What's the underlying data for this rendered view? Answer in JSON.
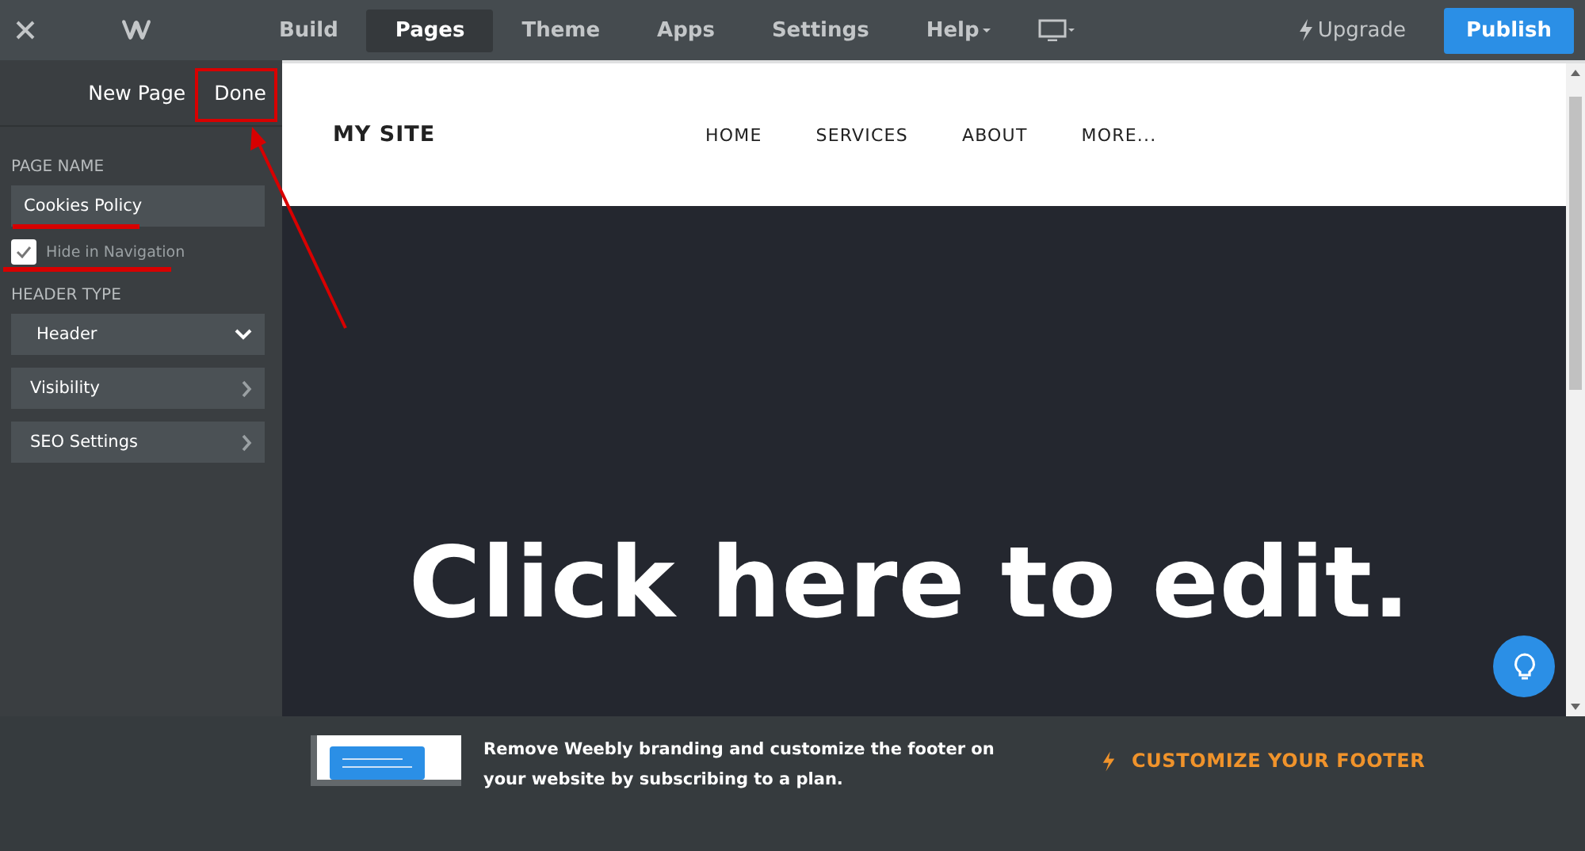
{
  "topbar": {
    "tabs": [
      {
        "label": "Build",
        "selected": false
      },
      {
        "label": "Pages",
        "selected": true
      },
      {
        "label": "Theme",
        "selected": false
      },
      {
        "label": "Apps",
        "selected": false
      },
      {
        "label": "Settings",
        "selected": false
      },
      {
        "label": "Help",
        "selected": false
      }
    ],
    "upgrade": "Upgrade",
    "publish": "Publish"
  },
  "sidebar": {
    "title": "New Page",
    "done": "Done",
    "page_name_label": "PAGE NAME",
    "page_name": "Cookies Policy",
    "hide_in_navigation": {
      "label": "Hide in Navigation",
      "checked": true
    },
    "header_type_label": "HEADER TYPE",
    "items": [
      {
        "kind": "select",
        "label": "Header"
      },
      {
        "kind": "link",
        "label": "Visibility"
      },
      {
        "kind": "link",
        "label": "SEO Settings"
      }
    ]
  },
  "site": {
    "title": "MY SITE",
    "nav": [
      "HOME",
      "SERVICES",
      "ABOUT",
      "MORE..."
    ],
    "hero": "Click here to edit."
  },
  "footer_banner": {
    "text": "Remove Weebly branding and customize the footer on your website by subscribing to a plan.",
    "action": "CUSTOMIZE YOUR FOOTER"
  }
}
